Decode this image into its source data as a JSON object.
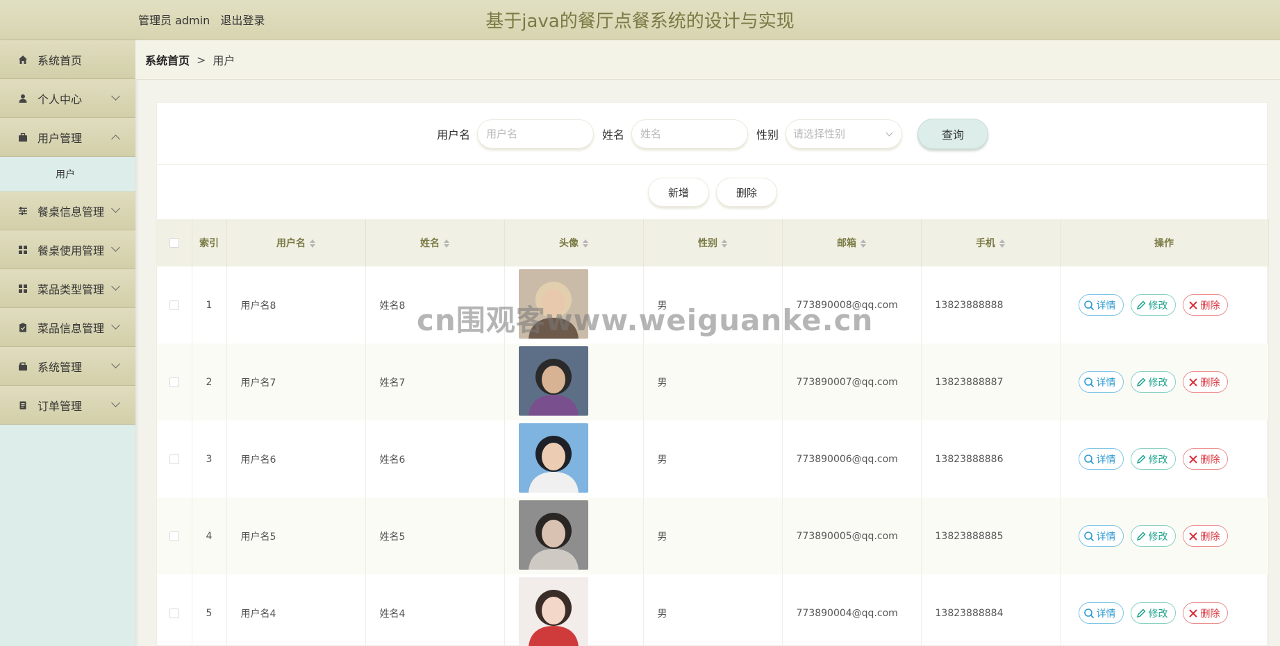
{
  "header": {
    "admin_label": "管理员 admin",
    "logout_label": "退出登录",
    "title": "基于java的餐厅点餐系统的设计与实现"
  },
  "sidebar": {
    "items": [
      {
        "label": "系统首页",
        "icon": "home-icon"
      },
      {
        "label": "个人中心",
        "icon": "user-icon"
      },
      {
        "label": "用户管理",
        "icon": "briefcase-icon",
        "expanded": true,
        "children": [
          {
            "label": "用户"
          }
        ]
      },
      {
        "label": "餐桌信息管理",
        "icon": "sliders-icon"
      },
      {
        "label": "餐桌使用管理",
        "icon": "grid-icon"
      },
      {
        "label": "菜品类型管理",
        "icon": "grid-icon"
      },
      {
        "label": "菜品信息管理",
        "icon": "clipboard-icon"
      },
      {
        "label": "系统管理",
        "icon": "toolbox-icon"
      },
      {
        "label": "订单管理",
        "icon": "receipt-icon"
      }
    ]
  },
  "breadcrumb": {
    "home": "系统首页",
    "separator": ">",
    "current": "用户"
  },
  "search": {
    "username_label": "用户名",
    "username_placeholder": "用户名",
    "name_label": "姓名",
    "name_placeholder": "姓名",
    "gender_label": "性别",
    "gender_placeholder": "请选择性别",
    "query_button": "查询"
  },
  "actions": {
    "add_button": "新增",
    "delete_button": "删除"
  },
  "table": {
    "columns": [
      "索引",
      "用户名",
      "姓名",
      "头像",
      "性别",
      "邮箱",
      "手机",
      "操作"
    ],
    "rows": [
      {
        "index": "1",
        "username": "用户名8",
        "name": "姓名8",
        "gender": "男",
        "email": "773890008@qq.com",
        "phone": "13823888888"
      },
      {
        "index": "2",
        "username": "用户名7",
        "name": "姓名7",
        "gender": "男",
        "email": "773890007@qq.com",
        "phone": "13823888887"
      },
      {
        "index": "3",
        "username": "用户名6",
        "name": "姓名6",
        "gender": "男",
        "email": "773890006@qq.com",
        "phone": "13823888886"
      },
      {
        "index": "4",
        "username": "用户名5",
        "name": "姓名5",
        "gender": "男",
        "email": "773890005@qq.com",
        "phone": "13823888885"
      },
      {
        "index": "5",
        "username": "用户名4",
        "name": "姓名4",
        "gender": "男",
        "email": "773890004@qq.com",
        "phone": "13823888884"
      }
    ],
    "row_actions": {
      "detail": "详情",
      "edit": "修改",
      "delete": "删除"
    }
  },
  "watermark": "cn围观客www.weiguanke.cn",
  "colors": {
    "accent_header": "#d7d4b0",
    "sidebar_bg": "#dcedea",
    "title_text": "#7a7a45",
    "detail": "#2e9ad1",
    "edit": "#1fa38d",
    "delete": "#d9303a"
  }
}
